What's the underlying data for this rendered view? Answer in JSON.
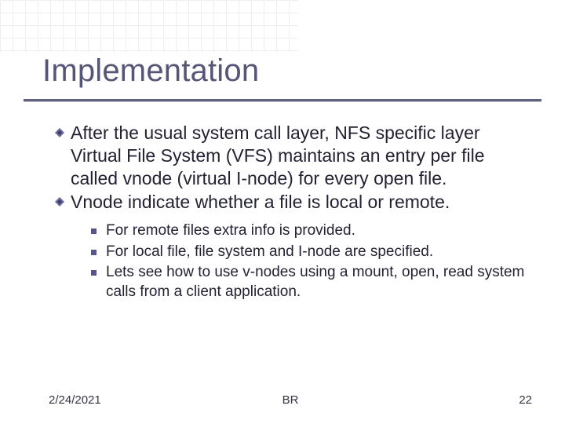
{
  "title": "Implementation",
  "bullets": [
    {
      "text": "After the usual system call layer, NFS specific layer Virtual File System (VFS) maintains an entry per file called vnode (virtual I-node) for every open file."
    },
    {
      "text": "Vnode indicate whether a file is local or remote."
    }
  ],
  "subbullets": [
    {
      "text": "For remote files extra info is provided."
    },
    {
      "text": "For local file, file system and I-node are specified."
    },
    {
      "text": "Lets see how to use v-nodes using a mount, open, read system calls from a client application."
    }
  ],
  "footer": {
    "date": "2/24/2021",
    "initials": "BR",
    "page": "22"
  },
  "colors": {
    "title": "#555577",
    "rule": "#606080",
    "bullet": "#55558a"
  }
}
